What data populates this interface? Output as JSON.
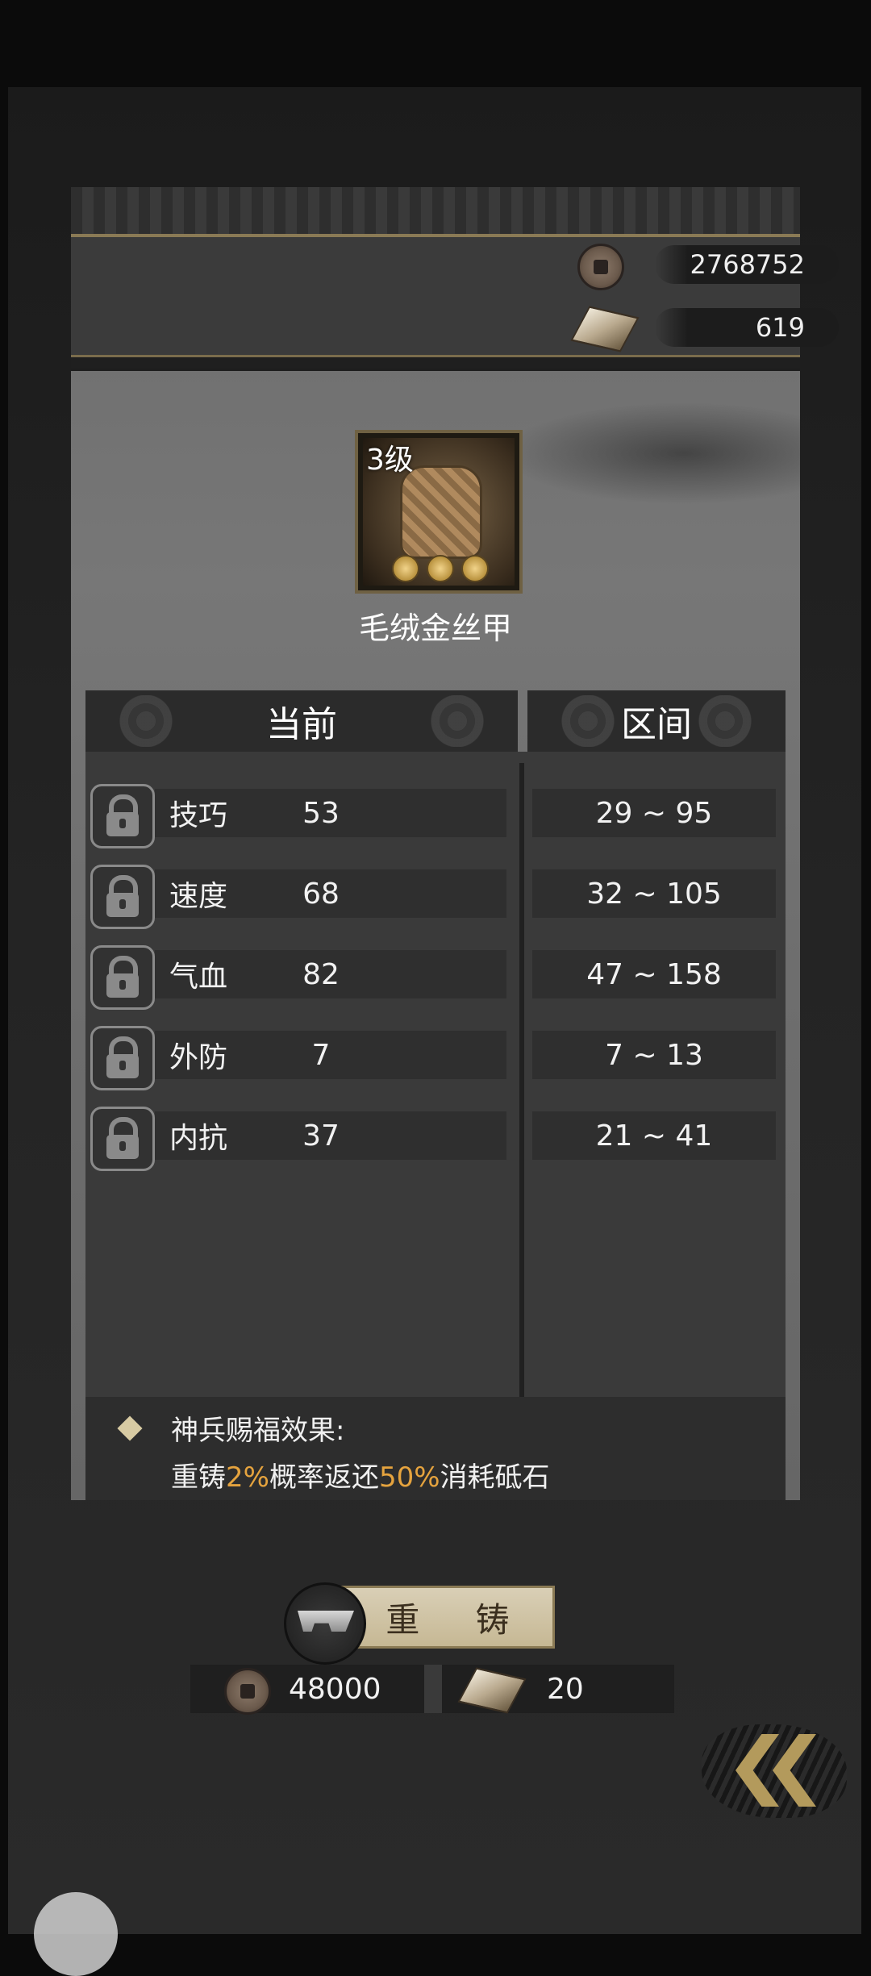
{
  "currencies": {
    "coins": "2768752",
    "stones": "619"
  },
  "item": {
    "level": "3级",
    "name": "毛绒金丝甲"
  },
  "columns": {
    "current": "当前",
    "range": "区间"
  },
  "stats": [
    {
      "name": "技巧",
      "value": "53",
      "range": "29 ~ 95"
    },
    {
      "name": "速度",
      "value": "68",
      "range": "32 ~ 105"
    },
    {
      "name": "气血",
      "value": "82",
      "range": "47 ~ 158"
    },
    {
      "name": "外防",
      "value": "7",
      "range": "7 ~ 13"
    },
    {
      "name": "内抗",
      "value": "37",
      "range": "21 ~ 41"
    }
  ],
  "effect": {
    "title": "神兵赐福效果:",
    "desc_prefix": "重铸",
    "desc_chance": "2%",
    "desc_middle": "概率返还",
    "desc_refund": "50%",
    "desc_suffix": "消耗砥石"
  },
  "recast": {
    "label": "重 铸",
    "cost_coins": "48000",
    "cost_stones": "20"
  },
  "colors": {
    "highlight": "#e5a33e",
    "button": "#d9cfb6",
    "gold": "#b39a5c"
  }
}
